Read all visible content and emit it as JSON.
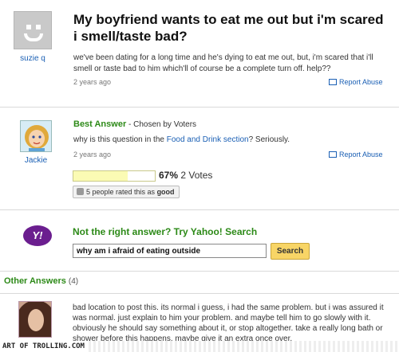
{
  "question": {
    "user": "suzie q",
    "title": "My boyfriend wants to eat me out but i'm scared i smell/taste bad?",
    "body": "we've been dating for a long time and he's dying to eat me out, but, i'm scared that i'll smell or taste bad to him which'll of course be a complete turn off. help??",
    "time": "2 years ago",
    "report": "Report Abuse"
  },
  "best_answer": {
    "label": "Best Answer",
    "chosen": " - Chosen by Voters",
    "user": "Jackie",
    "text_before": "why is this question in the ",
    "link": "Food and Drink section",
    "text_after": "? Seriously.",
    "time": "2 years ago",
    "report": "Report Abuse",
    "percent": "67%",
    "percent_value": 0.67,
    "votes": " 2 Votes",
    "rated_prefix": "5 people rated this as ",
    "rated_word": "good"
  },
  "search": {
    "logo": "Y!",
    "prompt": "Not the right answer? Try Yahoo! Search",
    "query": "why am i afraid of eating outside",
    "button": "Search"
  },
  "other_answers": {
    "title": "Other Answers",
    "count": "(4)",
    "first_body": "bad location to post this. its normal i guess, i had the same problem. but i was assured it was normal. just explain to him your problem. and maybe tell him to go slowly with it. obviously he should say something about it, or stop altogether. take a really long bath or shower before this happens. maybe give it an extra once over."
  },
  "watermark": "ART OF TROLLING.COM"
}
